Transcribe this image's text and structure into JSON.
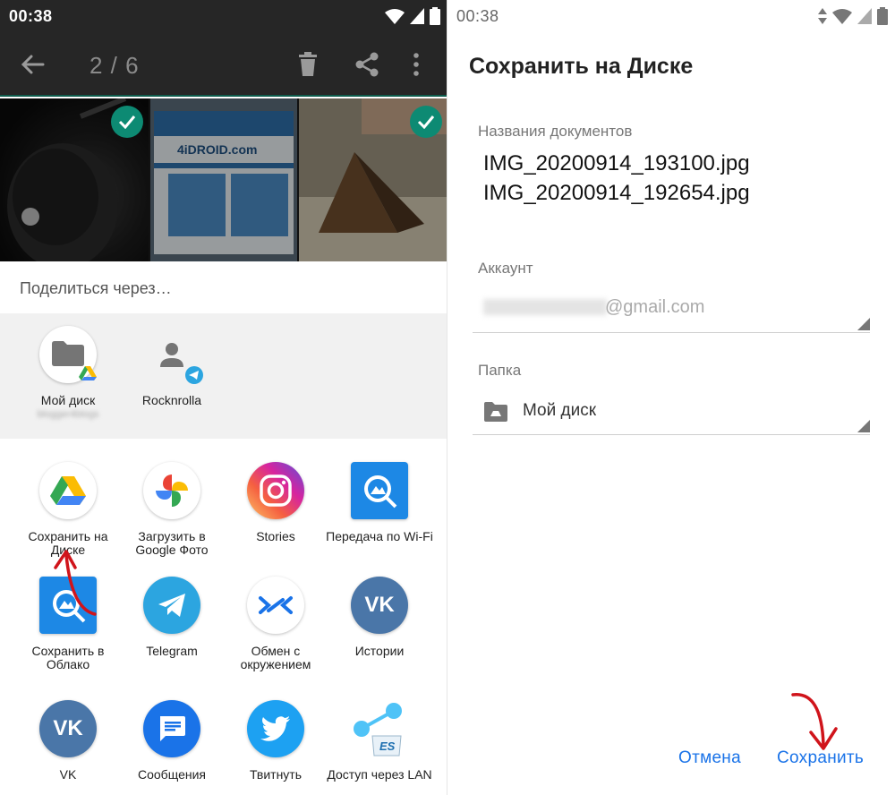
{
  "left": {
    "status_time": "00:38",
    "toolbar": {
      "counter": "2 / 6"
    },
    "share_title": "Поделиться через…",
    "direct_share": [
      {
        "label": "Мой диск",
        "sub": "blogger4blogs",
        "icon": "folder-drive-icon"
      },
      {
        "label": "Rocknrolla",
        "sub": "",
        "icon": "person-telegram-icon"
      }
    ],
    "apps": [
      {
        "label": "Сохранить на Диске",
        "icon": "google-drive-icon"
      },
      {
        "label": "Загрузить в Google Фото",
        "icon": "google-photos-icon"
      },
      {
        "label": "Stories",
        "icon": "instagram-icon"
      },
      {
        "label": "Передача по Wi-Fi",
        "icon": "es-wifi-transfer-icon"
      },
      {
        "label": "Сохранить в Облако",
        "icon": "es-cloud-icon"
      },
      {
        "label": "Telegram",
        "icon": "telegram-icon"
      },
      {
        "label": "Обмен с окружением",
        "icon": "nearby-share-icon"
      },
      {
        "label": "Истории",
        "icon": "vk-icon"
      },
      {
        "label": "VK",
        "icon": "vk-icon"
      },
      {
        "label": "Сообщения",
        "icon": "messages-icon"
      },
      {
        "label": "Твитнуть",
        "icon": "twitter-icon"
      },
      {
        "label": "Доступ через LAN",
        "icon": "es-lan-icon"
      }
    ],
    "photo_2_text": "4iDROID.com"
  },
  "right": {
    "status_time": "00:38",
    "dialog_title": "Сохранить на Диске",
    "doc_names_label": "Названия документов",
    "doc_names": [
      "IMG_20200914_193100.jpg",
      "IMG_20200914_192654.jpg"
    ],
    "account_label": "Аккаунт",
    "account_domain": "@gmail.com",
    "folder_label": "Папка",
    "folder_value": "Мой диск",
    "cancel_label": "Отмена",
    "save_label": "Сохранить"
  },
  "colors": {
    "accent_blue": "#1a73e8",
    "toolbar_dark": "#262626",
    "check_green": "#0d8a73",
    "annotation_red": "#d0141b"
  }
}
